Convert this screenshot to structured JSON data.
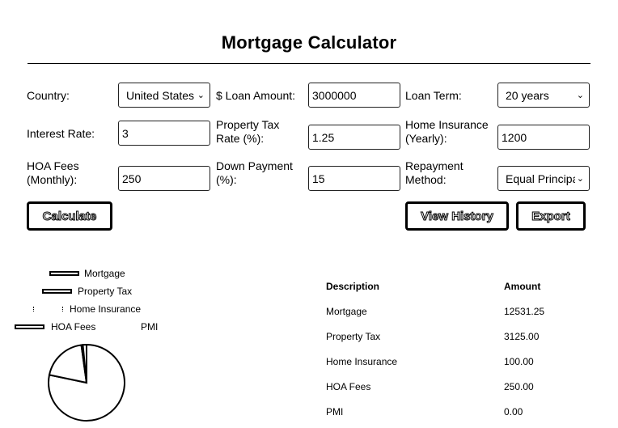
{
  "title": "Mortgage Calculator",
  "form": {
    "country": {
      "label": "Country:",
      "value": "United States"
    },
    "loan_amount": {
      "label": "$ Loan Amount:",
      "value": "3000000"
    },
    "loan_term": {
      "label": "Loan Term:",
      "value": "20 years"
    },
    "interest_rate": {
      "label": "Interest Rate:",
      "value": "3"
    },
    "property_tax": {
      "label_line1": "Property Tax",
      "label_line2": "Rate (%):",
      "value": "1.25"
    },
    "home_insurance": {
      "label_line1": "Home Insurance",
      "label_line2": "(Yearly):",
      "value": "1200"
    },
    "hoa_fees": {
      "label_line1": "HOA Fees",
      "label_line2": "(Monthly):",
      "value": "250"
    },
    "down_payment": {
      "label_line1": "Down Payment",
      "label_line2": "(%):",
      "value": "15"
    },
    "repayment_method": {
      "label_line1": "Repayment",
      "label_line2": "Method:",
      "value": "Equal Principal"
    }
  },
  "buttons": {
    "calculate": "Calculate",
    "view_history": "View History",
    "export": "Export"
  },
  "legend": {
    "mortgage": "Mortgage",
    "property_tax": "Property Tax",
    "home_insurance": "Home Insurance",
    "hoa_fees": "HOA Fees",
    "pmi": "PMI"
  },
  "chart_data": {
    "type": "pie",
    "labels": [
      "Mortgage",
      "Property Tax",
      "Home Insurance",
      "HOA Fees",
      "PMI"
    ],
    "values": [
      12531.25,
      3125.0,
      100.0,
      250.0,
      0.0
    ]
  },
  "table": {
    "headers": [
      "Description",
      "Amount"
    ],
    "rows": [
      [
        "Mortgage",
        "12531.25"
      ],
      [
        "Property Tax",
        "3125.00"
      ],
      [
        "Home Insurance",
        "100.00"
      ],
      [
        "HOA Fees",
        "250.00"
      ],
      [
        "PMI",
        "0.00"
      ]
    ]
  }
}
